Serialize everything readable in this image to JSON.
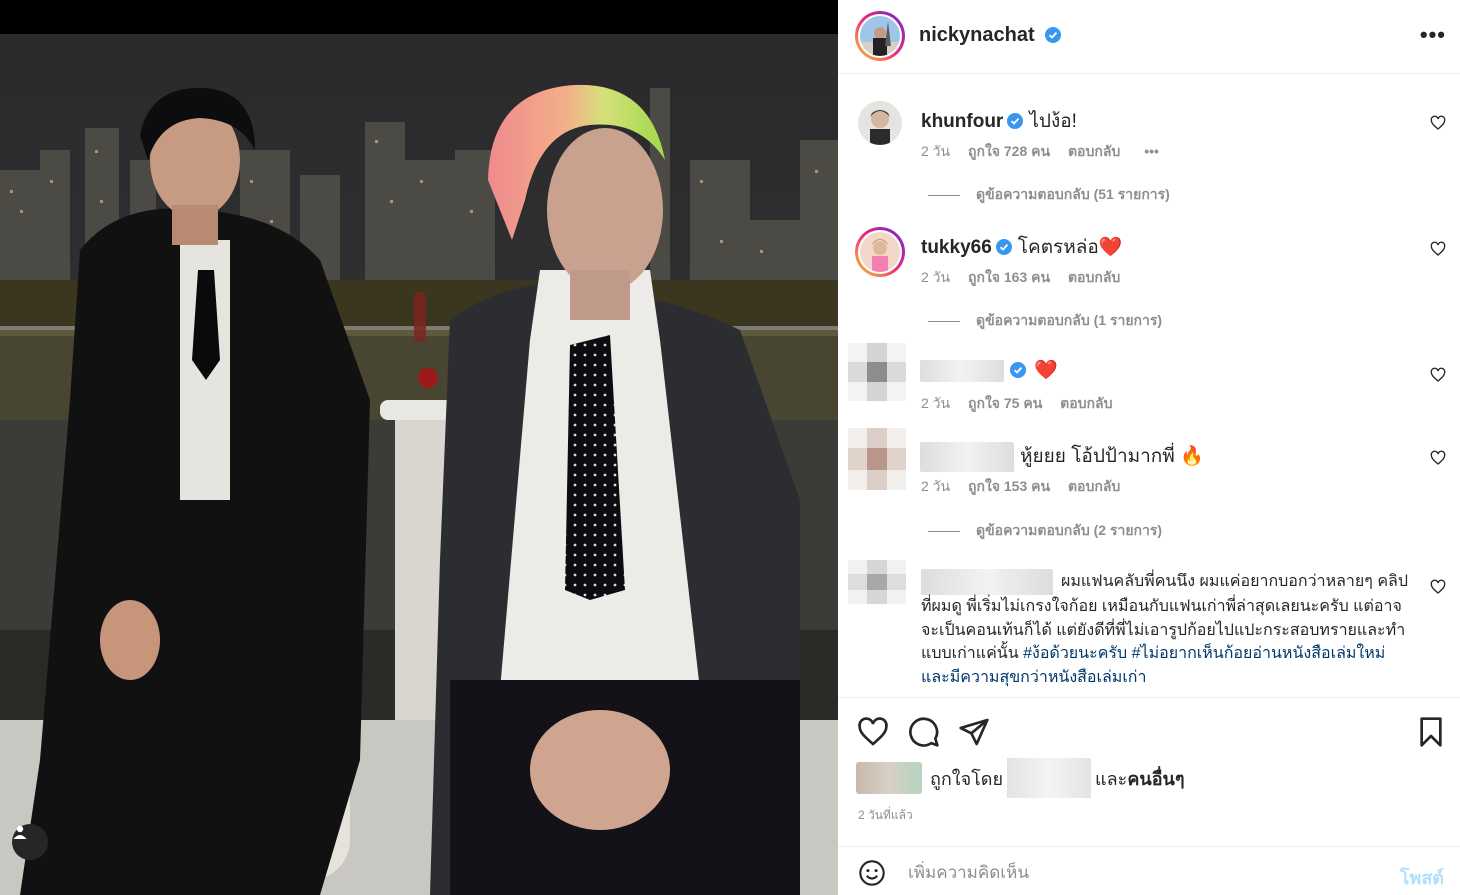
{
  "post": {
    "author": "nickynachat",
    "verified": true,
    "more_icon": "more-horizontal-icon",
    "more_label": "•••"
  },
  "comments": [
    {
      "username": "khunfour",
      "verified": true,
      "text": "ไปง้อ!",
      "time": "2 วัน",
      "likes": "ถูกใจ 728 คน",
      "reply": "ตอบกลับ",
      "more": "•••",
      "view_replies": "ดูข้อความตอบกลับ (51 รายการ)"
    },
    {
      "username": "tukky66",
      "verified": true,
      "text": "โคตรหล่อ❤️",
      "time": "2 วัน",
      "likes": "ถูกใจ 163 คน",
      "reply": "ตอบกลับ",
      "view_replies": "ดูข้อความตอบกลับ (1 รายการ)"
    },
    {
      "username": "",
      "verified": true,
      "text": "❤️",
      "time": "2 วัน",
      "likes": "ถูกใจ 75 คน",
      "reply": "ตอบกลับ"
    },
    {
      "username": "",
      "verified": false,
      "text": "หู้ยยย โอ้ปป้ามากพี่ 🔥",
      "time": "2 วัน",
      "likes": "ถูกใจ 153 คน",
      "reply": "ตอบกลับ",
      "view_replies": "ดูข้อความตอบกลับ (2 รายการ)"
    },
    {
      "username": "",
      "verified": false,
      "text_part1": "ผมแฟนคลับพี่คนนึง ผมแค่อยากบอกว่าหลายๆ คลิปที่ผมดู พี่เริ่มไม่เกรงใจก้อย เหมือนกับแฟนเก่าพี่ล่าสุดเลยนะครับ แต่อาจจะเป็นคอนเท้นก็ได้ แต่ยังดีที่พี่ไม่เอารูปก้อยไปแปะกระสอบทรายและทำแบบเก่าแค่นั้น",
      "hashtag1": "#ง้อด้วยนะครับ",
      "hashtag2": "#ไม่อยากเห็นก้อยอ่านหนังสือเล่มใหม่และมีความสุขกว่าหนังสือเล่มเก่า"
    }
  ],
  "actions": {
    "like_icon": "heart-icon",
    "comment_icon": "comment-bubble-icon",
    "share_icon": "paper-plane-icon",
    "save_icon": "bookmark-icon"
  },
  "liked_by": {
    "prefix": "ถูกใจโดย",
    "and": "และ",
    "others": "คนอื่นๆ"
  },
  "timeago": "2 วันที่แล้ว",
  "add_comment": {
    "emoji_icon": "emoji-smiley-icon",
    "placeholder": "เพิ่มความคิดเห็น",
    "post_label": "โพสต์"
  },
  "colors": {
    "verified": "#3897f0",
    "heart_red": "#ed4956",
    "link": "#00376b",
    "post_disabled": "#b2dffc",
    "muted": "#8e8e8e"
  }
}
